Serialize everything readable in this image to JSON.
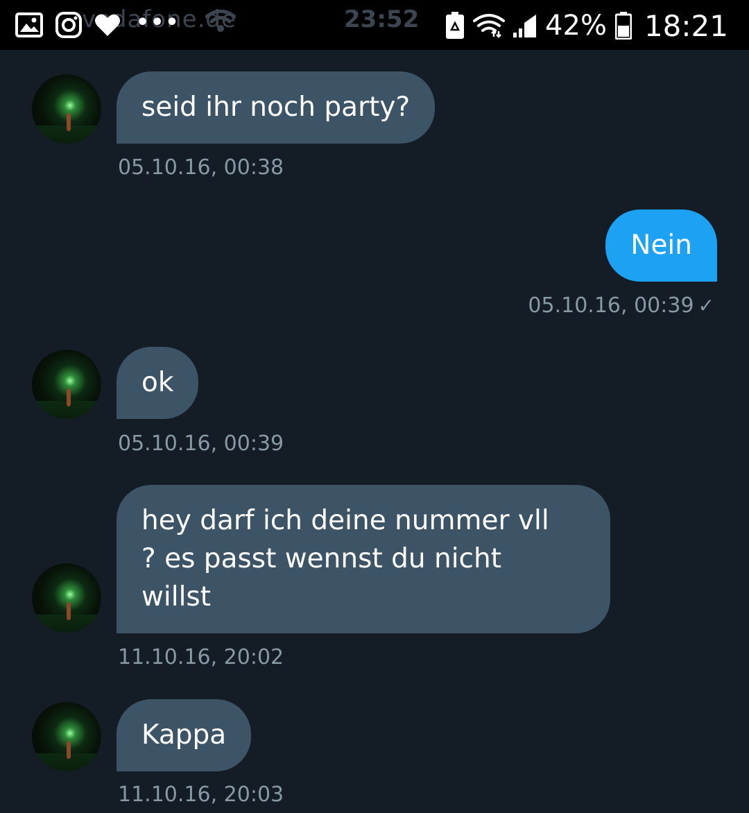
{
  "status_bar": {
    "carrier_ghost": "vodafone.de",
    "time_ghost": "23:52",
    "overflow_dots": "•••",
    "battery_percent": "42%",
    "clock": "18:21"
  },
  "messages": [
    {
      "direction": "incoming",
      "text": "seid ihr noch party?",
      "timestamp": "05.10.16, 00:38"
    },
    {
      "direction": "outgoing",
      "text": "Nein",
      "timestamp": "05.10.16, 00:39",
      "status": "✓"
    },
    {
      "direction": "incoming",
      "text": "ok",
      "timestamp": "05.10.16, 00:39"
    },
    {
      "direction": "incoming",
      "text": "hey darf ich deine   nummer vll\n? es passt wennst du nicht\nwillst",
      "timestamp": "11.10.16, 20:02"
    },
    {
      "direction": "incoming",
      "text": "Kappa",
      "timestamp": "11.10.16, 20:03"
    }
  ],
  "colors": {
    "background": "#141d26",
    "incoming_bubble": "#3d5466",
    "outgoing_bubble": "#1da1f2",
    "timestamp": "#8899a6",
    "status_bar": "#000000"
  }
}
